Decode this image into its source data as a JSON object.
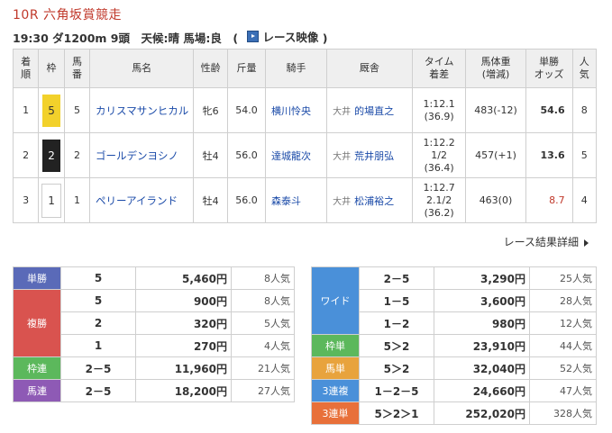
{
  "race": {
    "title": "10R 六角坂賞競走",
    "info": "19:30 ダ1200m 9頭　天候:晴 馬場:良　(",
    "video_label": "レース映像",
    "info_close": ")"
  },
  "table": {
    "headers": {
      "rank": "着\n順",
      "waku": "枠",
      "umaban": "馬\n番",
      "name": "馬名",
      "sexage": "性齢",
      "kinryo": "斤量",
      "jockey": "騎手",
      "trainer": "厩舎",
      "time": "タイム\n着差",
      "weight": "馬体重\n(増減)",
      "odds": "単勝\nオッズ",
      "pop": "人\n気"
    },
    "rows": [
      {
        "rank": "1",
        "waku": "5",
        "waku_bg": "#f2d12b",
        "waku_fg": "#333",
        "umaban": "5",
        "name": "カリスマサンヒカル",
        "sexage": "牝6",
        "kinryo": "54.0",
        "jockey": "横川怜央",
        "loc": "大井",
        "trainer": "的場直之",
        "time": "1:12.1\n(36.9)",
        "weight": "483(-12)",
        "odds": "54.6",
        "odds_red": false,
        "pop": "8"
      },
      {
        "rank": "2",
        "waku": "2",
        "waku_bg": "#222222",
        "waku_fg": "#fff",
        "umaban": "2",
        "name": "ゴールデンヨシノ",
        "sexage": "牡4",
        "kinryo": "56.0",
        "jockey": "達城龍次",
        "loc": "大井",
        "trainer": "荒井朋弘",
        "time": "1:12.2\n1/2\n(36.4)",
        "weight": "457(+1)",
        "odds": "13.6",
        "odds_red": false,
        "pop": "5"
      },
      {
        "rank": "3",
        "waku": "1",
        "waku_bg": "#ffffff",
        "waku_fg": "#333",
        "umaban": "1",
        "name": "ペリーアイランド",
        "sexage": "牡4",
        "kinryo": "56.0",
        "jockey": "森泰斗",
        "loc": "大井",
        "trainer": "松浦裕之",
        "time": "1:12.7\n2.1/2\n(36.2)",
        "weight": "463(0)",
        "odds": "8.7",
        "odds_red": true,
        "pop": "4"
      }
    ]
  },
  "detail_link": "レース結果詳細",
  "payouts_left": [
    {
      "label": "単勝",
      "color": "#5a6ab8",
      "rows": [
        {
          "combo": "5",
          "amount": "5,460円",
          "pop": "8人気"
        }
      ]
    },
    {
      "label": "複勝",
      "color": "#d9534f",
      "rows": [
        {
          "combo": "5",
          "amount": "900円",
          "pop": "8人気"
        },
        {
          "combo": "2",
          "amount": "320円",
          "pop": "5人気"
        },
        {
          "combo": "1",
          "amount": "270円",
          "pop": "4人気"
        }
      ]
    },
    {
      "label": "枠連",
      "color": "#5cb85c",
      "rows": [
        {
          "combo": "2－5",
          "amount": "11,960円",
          "pop": "21人気"
        }
      ]
    },
    {
      "label": "馬連",
      "color": "#8e5ab5",
      "rows": [
        {
          "combo": "2－5",
          "amount": "18,200円",
          "pop": "27人気"
        }
      ]
    }
  ],
  "payouts_right": [
    {
      "label": "ワイド",
      "color": "#4a90d9",
      "rows": [
        {
          "combo": "2－5",
          "amount": "3,290円",
          "pop": "25人気"
        },
        {
          "combo": "1－5",
          "amount": "3,600円",
          "pop": "28人気"
        },
        {
          "combo": "1－2",
          "amount": "980円",
          "pop": "12人気"
        }
      ]
    },
    {
      "label": "枠単",
      "color": "#5cb85c",
      "rows": [
        {
          "combo": "5＞2",
          "amount": "23,910円",
          "pop": "44人気"
        }
      ]
    },
    {
      "label": "馬単",
      "color": "#e8a33d",
      "rows": [
        {
          "combo": "5＞2",
          "amount": "32,040円",
          "pop": "52人気"
        }
      ]
    },
    {
      "label": "3連複",
      "color": "#4a90d9",
      "rows": [
        {
          "combo": "1－2－5",
          "amount": "24,660円",
          "pop": "47人気"
        }
      ]
    },
    {
      "label": "3連単",
      "color": "#e8703a",
      "rows": [
        {
          "combo": "5＞2＞1",
          "amount": "252,020円",
          "pop": "328人気"
        }
      ]
    }
  ]
}
